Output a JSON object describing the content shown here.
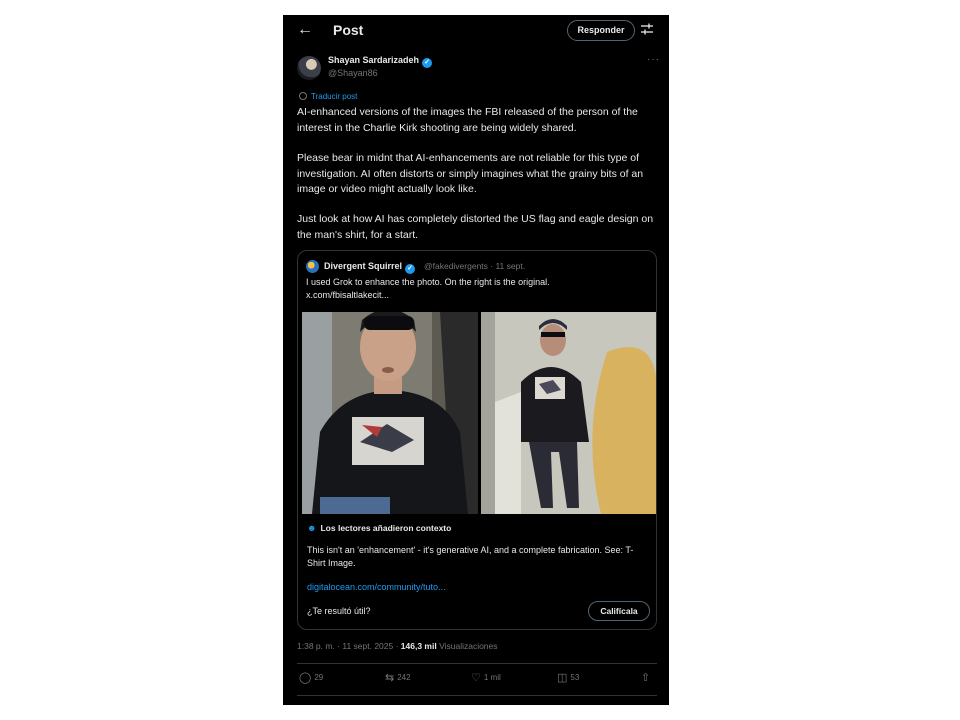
{
  "header": {
    "back_icon": "arrow-left-icon",
    "title": "Post",
    "reply_label": "Responder",
    "adjust_icon": "sliders-icon"
  },
  "post": {
    "author_name": "Shayan Sardarizadeh",
    "handle": "@Shayan86",
    "translate_label": "Traducir post",
    "paragraphs": [
      "AI-enhanced versions of the images the FBI released of the person of the interest in the Charlie Kirk shooting are being widely shared.",
      "Please bear in midnt that AI-enhancements are not reliable for this type of investigation. AI often distorts or simply imagines what the grainy bits of an image or video might actually look like.",
      "Just look at how AI has completely distorted the US flag and eagle design on the man's shirt, for a start."
    ],
    "timestamp": "1:38 p. m. · 11 sept. 2025 · ",
    "views_count": "146,3 mil",
    "views_label": " Visualizaciones"
  },
  "quote": {
    "author_name": "Divergent Squirrel",
    "meta": "@fakedivergents · 11 sept.",
    "text_line1": "I used Grok to enhance the photo. On the right is the original.",
    "text_line2": "x.com/fbisaltlakecit..."
  },
  "community_note": {
    "heading": "Los lectores añadieron contexto",
    "text": "This isn't an 'enhancement' - it's generative AI, and a complete fabrication. See: T-Shirt Image.",
    "link": "digitalocean.com/community/tuto...",
    "question": "¿Te resultó útil?",
    "rate_label": "Califícala"
  },
  "actions": {
    "replies": "29",
    "reposts": "242",
    "likes": "1 mil",
    "bookmarks": "53"
  },
  "colors": {
    "background": "#000000",
    "accent": "#1d9bf0",
    "muted": "#71767b",
    "text": "#e7e9ea"
  }
}
